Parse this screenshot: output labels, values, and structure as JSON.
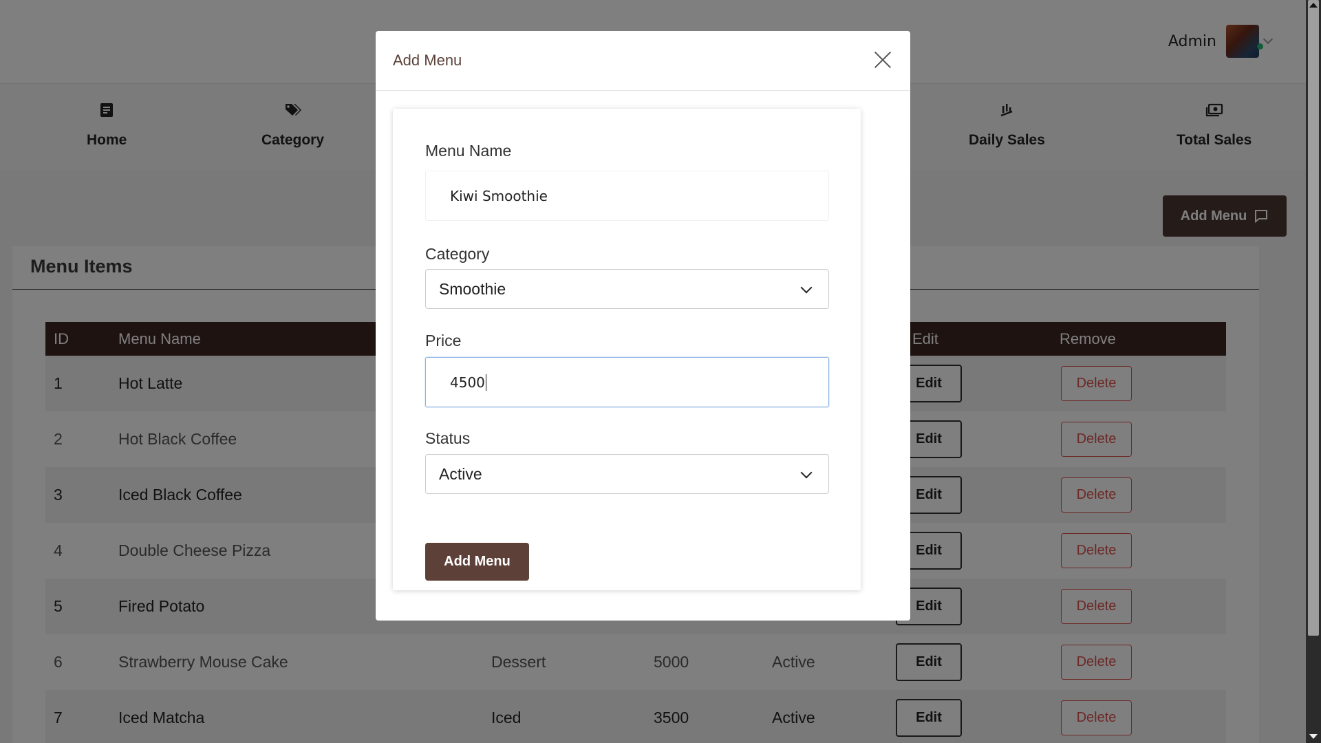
{
  "header": {
    "admin_name": "Admin"
  },
  "nav": {
    "home": "Home",
    "category": "Category",
    "daily_sales": "Daily Sales",
    "total_sales": "Total Sales"
  },
  "toolbar": {
    "add_menu_label": "Add Menu"
  },
  "card": {
    "title": "Menu Items"
  },
  "table": {
    "headers": {
      "id": "ID",
      "menu_name": "Menu Name",
      "edit": "Edit",
      "remove": "Remove"
    },
    "edit_label": "Edit",
    "delete_label": "Delete",
    "rows": [
      {
        "id": "1",
        "name": "Hot Latte",
        "category": "",
        "price": "",
        "status": ""
      },
      {
        "id": "2",
        "name": "Hot Black Coffee",
        "category": "",
        "price": "",
        "status": ""
      },
      {
        "id": "3",
        "name": "Iced Black Coffee",
        "category": "",
        "price": "",
        "status": ""
      },
      {
        "id": "4",
        "name": "Double Cheese Pizza",
        "category": "",
        "price": "",
        "status": ""
      },
      {
        "id": "5",
        "name": "Fired Potato",
        "category": "",
        "price": "",
        "status": ""
      },
      {
        "id": "6",
        "name": "Strawberry Mouse Cake",
        "category": "Dessert",
        "price": "5000",
        "status": "Active"
      },
      {
        "id": "7",
        "name": "Iced Matcha",
        "category": "Iced",
        "price": "3500",
        "status": "Active"
      }
    ]
  },
  "modal": {
    "title": "Add Menu",
    "menu_name_label": "Menu Name",
    "menu_name_value": "Kiwi Smoothie",
    "category_label": "Category",
    "category_value": "Smoothie",
    "price_label": "Price",
    "price_value": "4500",
    "status_label": "Status",
    "status_value": "Active",
    "submit_label": "Add Menu"
  },
  "colors": {
    "brand_dark": "#3e2723",
    "button_brown": "#5d4037",
    "delete_red": "#d9534f"
  }
}
